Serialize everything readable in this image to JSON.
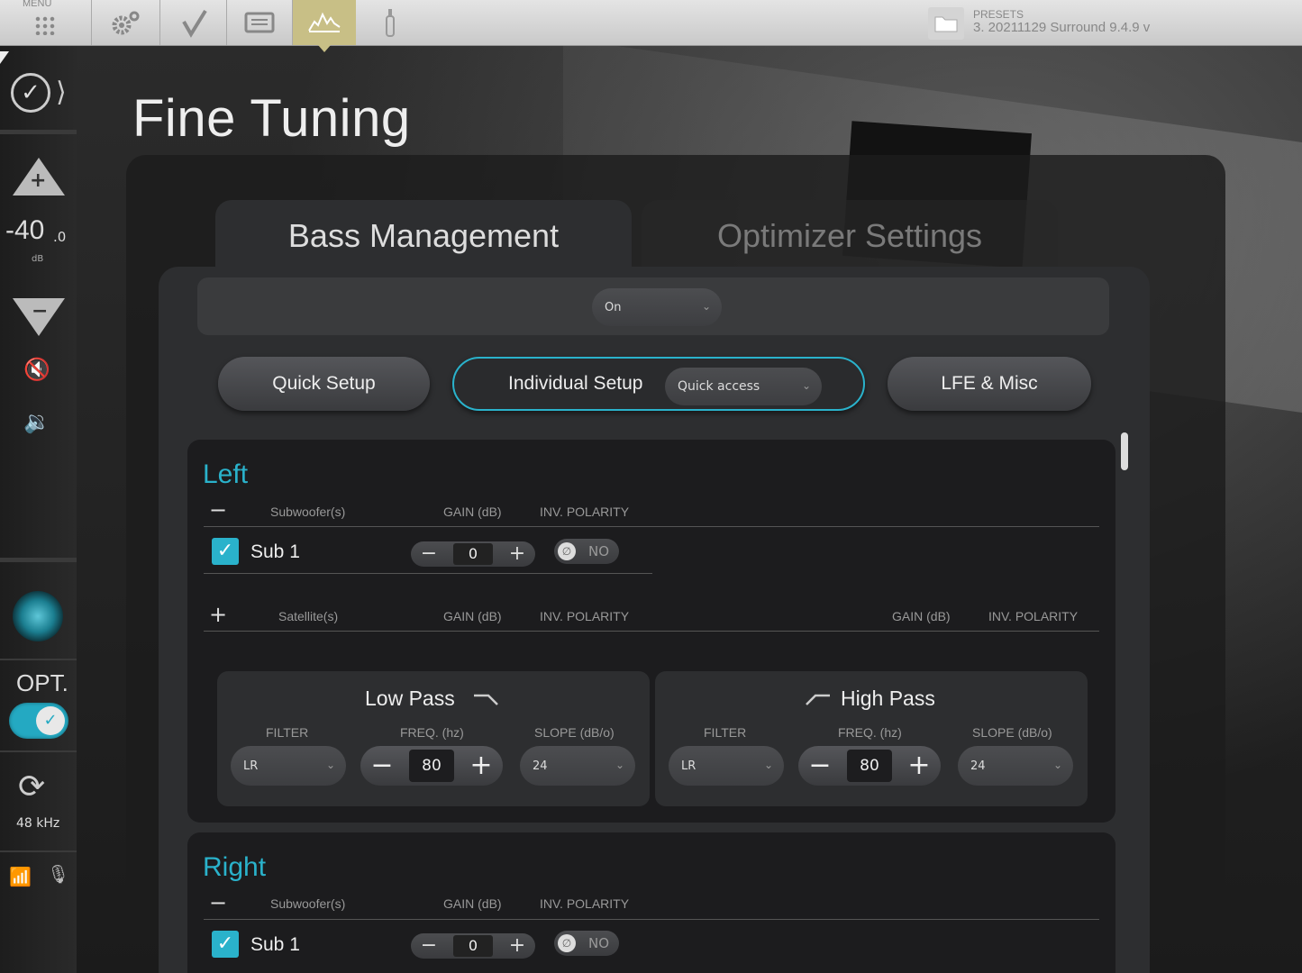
{
  "topbar": {
    "menu_label": "MENU",
    "icons": [
      "grid-icon",
      "gear-icon",
      "check-icon",
      "display-icon",
      "fine-tuning-icon",
      "microphone-icon"
    ],
    "active_index": 4,
    "presets_title": "PRESETS",
    "presets_value": "3. 20211129 Surround 9.4.9 v",
    "active_color": "#c8bf86"
  },
  "sidebar": {
    "volume": "-40",
    "volume_decimal": ".0",
    "volume_unit": "dB",
    "opt_label": "OPT.",
    "opt_enabled": true,
    "sample_rate": "48 kHz",
    "accent": "#2ab2cb"
  },
  "page": {
    "title": "Fine Tuning"
  },
  "tabs": [
    {
      "label": "Bass Management",
      "active": true
    },
    {
      "label": "Optimizer Settings",
      "active": false
    }
  ],
  "bass_management": {
    "state": "On",
    "segments": {
      "quick_setup": "Quick Setup",
      "individual_setup": "Individual Setup",
      "quick_access": "Quick access",
      "lfe_misc": "LFE & Misc",
      "selected": "Individual Setup"
    }
  },
  "channels": [
    {
      "name": "Left",
      "subwoofers_header": "Subwoofer(s)",
      "gain_header": "GAIN (dB)",
      "polarity_header": "INV. POLARITY",
      "subs": [
        {
          "label": "Sub 1",
          "checked": true,
          "gain": "0",
          "polarity": "NO"
        }
      ],
      "satellites_header": "Satellite(s)",
      "sat_gain_header": "GAIN (dB)",
      "sat_polarity_header": "INV. POLARITY",
      "sat_gain_header_2": "GAIN (dB)",
      "sat_polarity_header_2": "INV. POLARITY",
      "low_pass": {
        "title": "Low Pass",
        "filter_header": "FILTER",
        "freq_header": "FREQ. (hz)",
        "slope_header": "SLOPE (dB/o)",
        "filter": "LR",
        "freq": "80",
        "slope": "24"
      },
      "high_pass": {
        "title": "High Pass",
        "filter_header": "FILTER",
        "freq_header": "FREQ. (hz)",
        "slope_header": "SLOPE (dB/o)",
        "filter": "LR",
        "freq": "80",
        "slope": "24"
      }
    },
    {
      "name": "Right",
      "subwoofers_header": "Subwoofer(s)",
      "gain_header": "GAIN (dB)",
      "polarity_header": "INV. POLARITY",
      "subs": [
        {
          "label": "Sub 1",
          "checked": true,
          "gain": "0",
          "polarity": "NO"
        }
      ]
    }
  ]
}
